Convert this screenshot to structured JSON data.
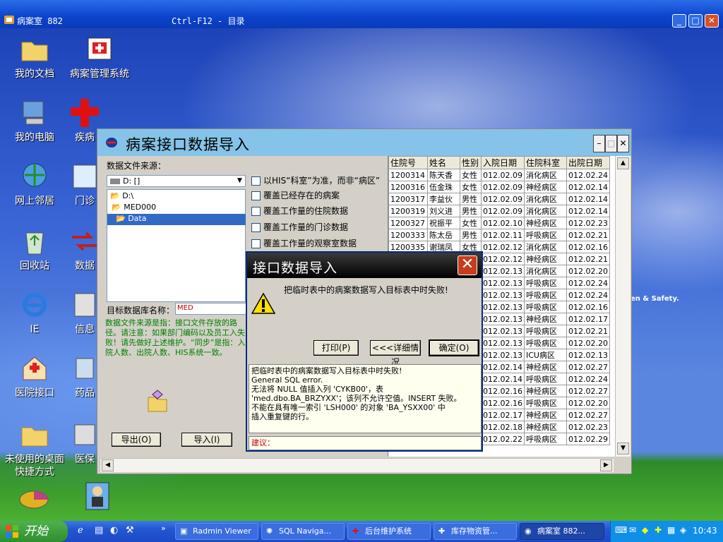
{
  "remote": {
    "title": "病案室 882",
    "subtitle": "Ctrl-F12 - 目录"
  },
  "desktop": {
    "icons": [
      "我的文档",
      "病案管理系统",
      "我的电脑",
      "疾病",
      "网上邻居",
      "门诊",
      "回收站",
      "数据",
      "IE",
      "信息",
      "医院接口",
      "药品",
      "未使用的桌面快捷方式",
      "医保"
    ],
    "wallpaper_text": "en & Safety."
  },
  "app": {
    "title": "病案接口数据导入",
    "source_label": "数据文件来源：",
    "drive": "D: []",
    "tree": [
      "D:\\",
      "MED000",
      "Data"
    ],
    "options": [
      "以HIS“科室”为准，而非“病区”",
      "覆盖已经存在的病案",
      "覆盖工作量的住院数据",
      "覆盖工作量的门诊数据",
      "覆盖工作量的观察室数据"
    ],
    "db_label": "目标数据库名称：",
    "db_value": "MED",
    "help_text": "数据文件来源是指：接口文件存放的路径。请注意：如果部门编码以及员工入失败！请先做好上述维护。“同步”是指：入院人数、出院人数、HIS系统一致。",
    "export_button": "导出(O)",
    "import_button": "导入(I)"
  },
  "grid": {
    "columns": [
      "住院号",
      "姓名",
      "性别",
      "入院日期",
      "住院科室",
      "出院日期"
    ],
    "rows": [
      [
        "1200314",
        "陈天香",
        "女性",
        "012.02.09",
        "消化病区",
        "012.02.24"
      ],
      [
        "1200316",
        "伍金珠",
        "女性",
        "012.02.09",
        "神经病区",
        "012.02.14"
      ],
      [
        "1200317",
        "李益伙",
        "男性",
        "012.02.09",
        "消化病区",
        "012.02.14"
      ],
      [
        "1200319",
        "刘义进",
        "男性",
        "012.02.09",
        "消化病区",
        "012.02.14"
      ],
      [
        "1200327",
        "祝振平",
        "女性",
        "012.02.10",
        "神经病区",
        "012.02.23"
      ],
      [
        "1200333",
        "陈太岳",
        "男性",
        "012.02.11",
        "呼吸病区",
        "012.02.21"
      ],
      [
        "1200335",
        "谢瑞凤",
        "女性",
        "012.02.12",
        "消化病区",
        "012.02.16"
      ],
      [
        "",
        "",
        "",
        "012.02.12",
        "神经病区",
        "012.02.21"
      ],
      [
        "",
        "",
        "",
        "012.02.13",
        "消化病区",
        "012.02.20"
      ],
      [
        "",
        "",
        "",
        "012.02.13",
        "呼吸病区",
        "012.02.24"
      ],
      [
        "",
        "",
        "",
        "012.02.13",
        "呼吸病区",
        "012.02.24"
      ],
      [
        "",
        "",
        "",
        "012.02.13",
        "呼吸病区",
        "012.02.16"
      ],
      [
        "",
        "",
        "",
        "012.02.13",
        "神经病区",
        "012.02.17"
      ],
      [
        "",
        "",
        "",
        "012.02.13",
        "呼吸病区",
        "012.02.21"
      ],
      [
        "",
        "",
        "",
        "012.02.13",
        "呼吸病区",
        "012.02.20"
      ],
      [
        "",
        "",
        "",
        "012.02.13",
        "ICU病区",
        "012.02.13"
      ],
      [
        "",
        "",
        "",
        "012.02.14",
        "神经病区",
        "012.02.27"
      ],
      [
        "",
        "",
        "",
        "012.02.14",
        "呼吸病区",
        "012.02.24"
      ],
      [
        "",
        "",
        "",
        "012.02.16",
        "神经病区",
        "012.02.27"
      ],
      [
        "",
        "",
        "",
        "012.02.16",
        "呼吸病区",
        "012.02.20"
      ],
      [
        "",
        "",
        "",
        "012.02.17",
        "神经病区",
        "012.02.27"
      ],
      [
        "",
        "",
        "",
        "012.02.18",
        "神经病区",
        "012.02.23"
      ],
      [
        "",
        "",
        "",
        "012.02.22",
        "呼吸病区",
        "012.02.29"
      ]
    ]
  },
  "dialog": {
    "title": "接口数据导入",
    "message": "把临时表中的病案数据写入目标表中时失败!",
    "print_button": "打印(P)",
    "details_button": "<<<详细情况",
    "ok_button": "确定(O)",
    "details": "把临时表中的病案数据写入目标表中时失败!\nGeneral SQL error.\n无法将 NULL 值插入列 'CYKB00'，表\n'med.dbo.BA_BRZYXX'；该列不允许空值。INSERT 失败。\n不能在具有唯一索引 'LSH000' 的对象 'BA_YSXX00' 中\n插入重复键的行。",
    "suggest_label": "建议："
  },
  "taskbar": {
    "start": "开始",
    "items": [
      "Radmin Viewer",
      "SQL Naviga...",
      "后台维护系统",
      "库存物资管...",
      "病案室 882..."
    ],
    "clock": "10:43"
  }
}
